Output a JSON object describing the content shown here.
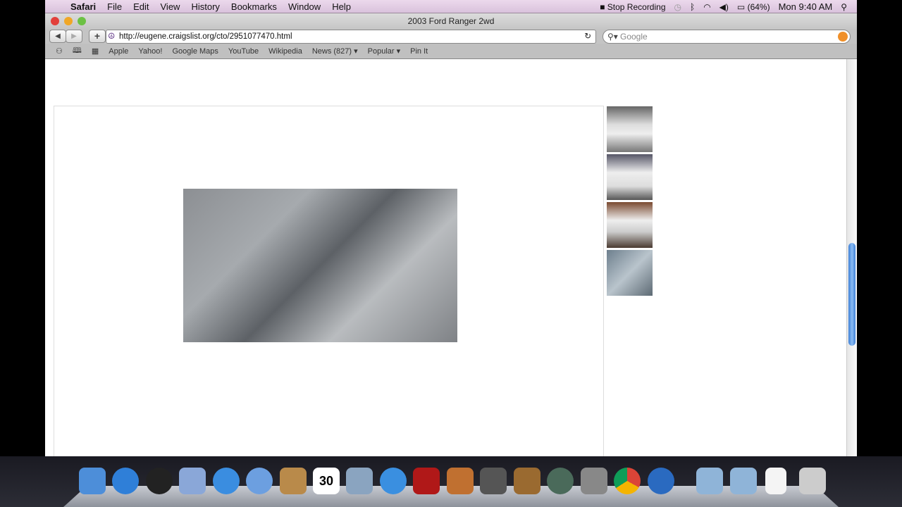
{
  "menubar": {
    "items": [
      "Safari",
      "File",
      "Edit",
      "View",
      "History",
      "Bookmarks",
      "Window",
      "Help"
    ],
    "stop_recording": "Stop Recording",
    "battery": "(64%)",
    "clock": "Mon 9:40 AM"
  },
  "window": {
    "title": "2003 Ford Ranger 2wd"
  },
  "toolbar": {
    "url": "http://eugene.craigslist.org/cto/2951077470.html",
    "search_placeholder": "Google",
    "back": "◀",
    "forward": "▶",
    "add": "+"
  },
  "bookmarks": [
    "Apple",
    "Yahoo!",
    "Google Maps",
    "YouTube",
    "Wikipedia",
    "News (827) ▾",
    "Popular ▾",
    "Pin It"
  ],
  "dock": [
    "Finder",
    "App Store",
    "Dashboard",
    "Mail",
    "Safari",
    "FaceTime",
    "Address Book",
    "iCal",
    "iPhoto",
    "iTunes",
    "Photo Booth",
    "Image Capture",
    "iMovie",
    "GarageBand",
    "Time Machine",
    "System Preferences",
    "Chrome",
    "QuickTime",
    "Applications",
    "Documents",
    "File",
    "Trash"
  ],
  "calendar_day": "30"
}
